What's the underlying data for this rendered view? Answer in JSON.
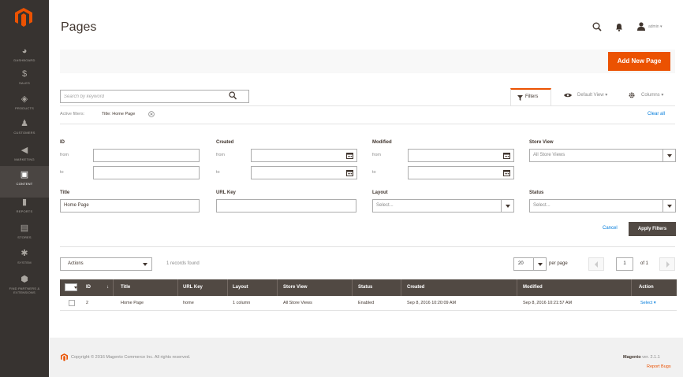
{
  "sidebar": {
    "items": [
      {
        "label": "DASHBOARD",
        "icon": "dashboard-icon"
      },
      {
        "label": "SALES",
        "icon": "dollar-icon"
      },
      {
        "label": "PRODUCTS",
        "icon": "cube-icon"
      },
      {
        "label": "CUSTOMERS",
        "icon": "person-icon"
      },
      {
        "label": "MARKETING",
        "icon": "megaphone-icon"
      },
      {
        "label": "CONTENT",
        "icon": "layout-icon"
      },
      {
        "label": "REPORTS",
        "icon": "bar-chart-icon"
      },
      {
        "label": "STORES",
        "icon": "store-icon"
      },
      {
        "label": "SYSTEM",
        "icon": "gear-icon"
      },
      {
        "label": "FIND PARTNERS & EXTENSIONS",
        "icon": "box-icon"
      }
    ]
  },
  "header": {
    "title": "Pages",
    "user": "admin ▾"
  },
  "actions": {
    "add_new": "Add New Page"
  },
  "search": {
    "placeholder": "Search by keyword"
  },
  "toolbar": {
    "filters": "Filters",
    "default_view": "Default View ▾",
    "columns": "Columns ▾"
  },
  "active_filters": {
    "label": "Active filters:",
    "value": "Title: Home Page",
    "clear_all": "Clear all"
  },
  "filters": {
    "id_label": "ID",
    "created_label": "Created",
    "modified_label": "Modified",
    "store_view_label": "Store View",
    "from": "from",
    "to": "to",
    "store_view_value": "All Store Views",
    "title_label": "Title",
    "title_value": "Home Page",
    "url_key_label": "URL Key",
    "layout_label": "Layout",
    "layout_value": "Select...",
    "status_label": "Status",
    "status_value": "Select...",
    "cancel": "Cancel",
    "apply": "Apply Filters"
  },
  "grid": {
    "actions_label": "Actions",
    "records": "1 records found",
    "per_page_value": "20",
    "per_page_label": "per page",
    "current_page": "1",
    "of_pages": "of 1",
    "columns": [
      "ID",
      "Title",
      "URL Key",
      "Layout",
      "Store View",
      "Status",
      "Created",
      "Modified",
      "Action"
    ],
    "rows": [
      {
        "id": "2",
        "title": "Home Page",
        "url_key": "home",
        "layout": "1 column",
        "store_view": "All Store Views",
        "status": "Enabled",
        "created": "Sep 8, 2016 10:20:09 AM",
        "modified": "Sep 8, 2016 10:21:57 AM",
        "action": "Select ▾"
      }
    ]
  },
  "footer": {
    "copyright": "Copyright © 2016 Magento Commerce Inc. All rights reserved.",
    "brand": "Magento",
    "version": "ver. 2.1.1",
    "report_bug": "Report Bugs"
  },
  "colors": {
    "accent": "#eb5202",
    "sidebar": "#373330",
    "grid_header": "#514943",
    "link": "#007bdb"
  }
}
